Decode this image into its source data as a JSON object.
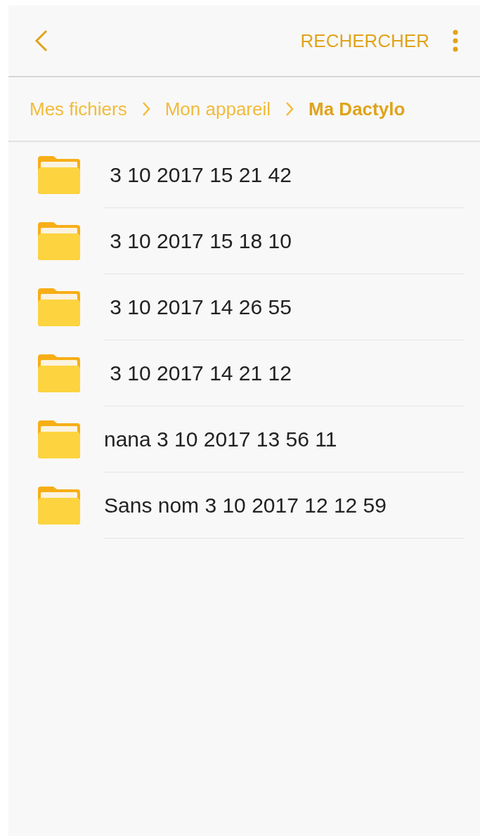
{
  "toolbar": {
    "action": "RECHERCHER"
  },
  "breadcrumb": [
    {
      "label": "Mes fichiers",
      "current": false
    },
    {
      "label": "Mon appareil",
      "current": false
    },
    {
      "label": "Ma Dactylo",
      "current": true
    }
  ],
  "folders": [
    {
      "name": " 3 10 2017 15 21 42"
    },
    {
      "name": " 3 10 2017 15 18 10"
    },
    {
      "name": " 3 10 2017 14 26 55"
    },
    {
      "name": " 3 10 2017 14 21 12"
    },
    {
      "name": "nana 3 10 2017 13 56 11"
    },
    {
      "name": "Sans nom 3 10 2017 12 12 59"
    }
  ]
}
